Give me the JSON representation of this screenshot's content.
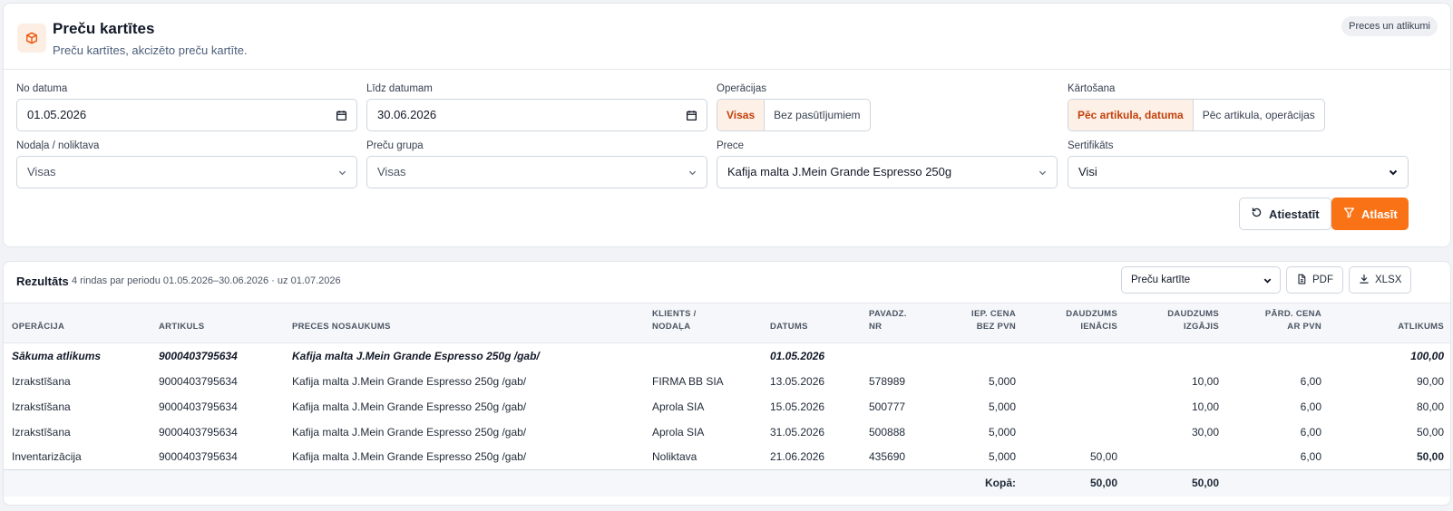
{
  "header": {
    "title": "Preču kartītes",
    "subtitle": "Preču kartītes, akcizēto preču kartīte.",
    "badge": "Preces un atlikumi",
    "icon": "box-icon",
    "accent": "#f97316"
  },
  "filters": {
    "date_from": {
      "label": "No datuma",
      "value": "01.05.2026"
    },
    "date_to": {
      "label": "Līdz datumam",
      "value": "30.06.2026"
    },
    "operations": {
      "label": "Operācijas",
      "options": [
        "Visas",
        "Bez pasūtījumiem"
      ],
      "selected": "Visas"
    },
    "sorting": {
      "label": "Kārtošana",
      "options": [
        "Pēc artikula, datuma",
        "Pēc artikula, operācijas"
      ],
      "selected": "Pēc artikula, datuma"
    },
    "department": {
      "label": "Nodaļa / noliktava",
      "value": "Visas"
    },
    "group": {
      "label": "Preču grupa",
      "value": "Visas"
    },
    "product": {
      "label": "Prece",
      "value": "Kafija malta J.Mein Grande Espresso 250g"
    },
    "certificate": {
      "label": "Sertifikāts",
      "value": "Visi"
    },
    "reset_label": "Atiestatīt",
    "apply_label": "Atlasīt"
  },
  "results": {
    "title": "Rezultāts",
    "meta": "4 rindas par periodu 01.05.2026–30.06.2026 · uz 01.07.2026",
    "report_select": "Preču kartīte",
    "pdf_label": "PDF",
    "xlsx_label": "XLSX",
    "columns": {
      "operation": "Operācija",
      "article": "Artikuls",
      "name": "Preces nosaukums",
      "client_1": "Klients /",
      "client_2": "nodaļa",
      "date": "Datums",
      "invoice_1": "Pavadz.",
      "invoice_2": "Nr",
      "cost_1": "Iep. cena",
      "cost_2": "bez PVN",
      "in_1": "Daudzums",
      "in_2": "ienācis",
      "out_1": "Daudzums",
      "out_2": "izgājis",
      "sale_1": "Pārd. cena",
      "sale_2": "ar PVN",
      "balance": "Atlikums"
    },
    "opening": {
      "operation": "Sākuma atlikums",
      "article": "9000403795634",
      "name": "Kafija malta J.Mein Grande Espresso 250g /gab/",
      "date": "01.05.2026",
      "balance": "100,00"
    },
    "rows": [
      {
        "operation": "Izrakstīšana",
        "article": "9000403795634",
        "name": "Kafija malta J.Mein Grande Espresso 250g /gab/",
        "client": "FIRMA BB SIA",
        "date": "13.05.2026",
        "invoice": "578989",
        "cost": "5,000",
        "in": "",
        "out": "10,00",
        "sale": "6,00",
        "balance": "90,00"
      },
      {
        "operation": "Izrakstīšana",
        "article": "9000403795634",
        "name": "Kafija malta J.Mein Grande Espresso 250g /gab/",
        "client": "Aprola SIA",
        "date": "15.05.2026",
        "invoice": "500777",
        "cost": "5,000",
        "in": "",
        "out": "10,00",
        "sale": "6,00",
        "balance": "80,00"
      },
      {
        "operation": "Izrakstīšana",
        "article": "9000403795634",
        "name": "Kafija malta J.Mein Grande Espresso 250g /gab/",
        "client": "Aprola SIA",
        "date": "31.05.2026",
        "invoice": "500888",
        "cost": "5,000",
        "in": "",
        "out": "30,00",
        "sale": "6,00",
        "balance": "50,00"
      },
      {
        "operation": "Inventarizācija",
        "article": "9000403795634",
        "name": "Kafija malta J.Mein Grande Espresso 250g /gab/",
        "client": "Noliktava",
        "date": "21.06.2026",
        "invoice": "435690",
        "cost": "5,000",
        "in": "50,00",
        "out": "",
        "sale": "6,00",
        "balance": "50,00"
      }
    ],
    "totals": {
      "label": "Kopā:",
      "in": "50,00",
      "out": "50,00"
    }
  }
}
